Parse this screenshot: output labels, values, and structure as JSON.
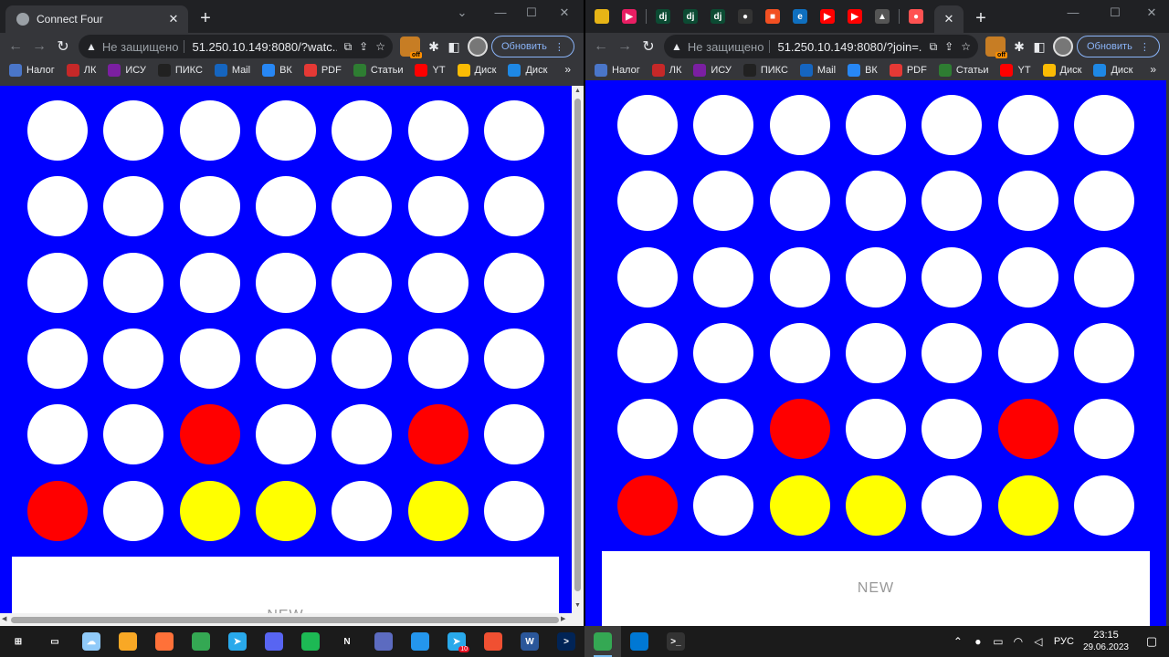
{
  "left_window": {
    "tab_title": "Connect Four",
    "address": {
      "not_secure": "Не защищено",
      "url": "51.250.10.149:8080/?watc..."
    },
    "update_label": "Обновить",
    "new_label": "NEW",
    "board": [
      [
        "empty",
        "empty",
        "empty",
        "empty",
        "empty",
        "empty",
        "empty"
      ],
      [
        "empty",
        "empty",
        "empty",
        "empty",
        "empty",
        "empty",
        "empty"
      ],
      [
        "empty",
        "empty",
        "empty",
        "empty",
        "empty",
        "empty",
        "empty"
      ],
      [
        "empty",
        "empty",
        "empty",
        "empty",
        "empty",
        "empty",
        "empty"
      ],
      [
        "empty",
        "empty",
        "red",
        "empty",
        "empty",
        "red",
        "empty"
      ],
      [
        "red",
        "empty",
        "yellow",
        "yellow",
        "empty",
        "yellow",
        "empty"
      ]
    ]
  },
  "right_window": {
    "address": {
      "not_secure": "Не защищено",
      "url": "51.250.10.149:8080/?join=..."
    },
    "update_label": "Обновить",
    "new_label": "NEW",
    "pinned_tabs": [
      {
        "icon": "pinwheel-icon",
        "label": "",
        "color": "#e7b416"
      },
      {
        "icon": "play-icon",
        "label": "▶",
        "color": "#e91e63"
      },
      {
        "icon": "django-icon",
        "label": "dj",
        "color": "#0c4b33"
      },
      {
        "icon": "django-icon",
        "label": "dj",
        "color": "#0c4b33"
      },
      {
        "icon": "django-icon",
        "label": "dj",
        "color": "#0c4b33"
      },
      {
        "icon": "github-icon",
        "label": "●",
        "color": "#333333"
      },
      {
        "icon": "microsoft-icon",
        "label": "■",
        "color": "#f25022"
      },
      {
        "icon": "edge-icon",
        "label": "e",
        "color": "#0f6fbf"
      },
      {
        "icon": "youtube-icon",
        "label": "▶",
        "color": "#ff0000"
      },
      {
        "icon": "youtube-icon",
        "label": "▶",
        "color": "#ff0000"
      },
      {
        "icon": "tent-icon",
        "label": "▲",
        "color": "#555555"
      },
      {
        "icon": "record-icon",
        "label": "●",
        "color": "#ff5252"
      }
    ],
    "board": [
      [
        "empty",
        "empty",
        "empty",
        "empty",
        "empty",
        "empty",
        "empty"
      ],
      [
        "empty",
        "empty",
        "empty",
        "empty",
        "empty",
        "empty",
        "empty"
      ],
      [
        "empty",
        "empty",
        "empty",
        "empty",
        "empty",
        "empty",
        "empty"
      ],
      [
        "empty",
        "empty",
        "empty",
        "empty",
        "empty",
        "empty",
        "empty"
      ],
      [
        "empty",
        "empty",
        "red",
        "empty",
        "empty",
        "red",
        "empty"
      ],
      [
        "red",
        "empty",
        "yellow",
        "yellow",
        "empty",
        "yellow",
        "empty"
      ]
    ]
  },
  "bookmarks": [
    {
      "label": "Налог",
      "icon": "tax-icon",
      "color": "#4a76c9"
    },
    {
      "label": "ЛК",
      "icon": "lk-icon",
      "color": "#c62828"
    },
    {
      "label": "ИСУ",
      "icon": "isu-icon",
      "color": "#7b1fa2"
    },
    {
      "label": "ПИКС",
      "icon": "piks-icon",
      "color": "#212121"
    },
    {
      "label": "Mail",
      "icon": "mail-icon",
      "color": "#1565c0"
    },
    {
      "label": "ВК",
      "icon": "vk-icon",
      "color": "#2787f5"
    },
    {
      "label": "PDF",
      "icon": "pdf-icon",
      "color": "#e53935"
    },
    {
      "label": "Статьи",
      "icon": "articles-icon",
      "color": "#2e7d32"
    },
    {
      "label": "YT",
      "icon": "youtube-icon",
      "color": "#ff0000"
    },
    {
      "label": "Диск",
      "icon": "drive-icon",
      "color": "#fbbc04"
    },
    {
      "label": "Диск",
      "icon": "drive-icon",
      "color": "#1e88e5"
    }
  ],
  "colors": {
    "board": "#0000ff",
    "red": "#ff0000",
    "yellow": "#ffff00",
    "empty": "#ffffff"
  },
  "taskbar": {
    "apps": [
      {
        "name": "start-button",
        "icon": "windows-icon",
        "color": "#ffffff",
        "label": "⊞"
      },
      {
        "name": "task-view-button",
        "icon": "task-view-icon",
        "color": "#ffffff",
        "label": "▭"
      },
      {
        "name": "weather-widget",
        "icon": "weather-icon",
        "color": "#90caf9",
        "label": "☁"
      },
      {
        "name": "explorer-button",
        "icon": "folder-icon",
        "color": "#f9a825",
        "label": ""
      },
      {
        "name": "firefox-button",
        "icon": "firefox-icon",
        "color": "#ff7139",
        "label": ""
      },
      {
        "name": "chrome-button",
        "icon": "chrome-icon",
        "color": "#34a853",
        "label": ""
      },
      {
        "name": "telegram-button",
        "icon": "telegram-icon",
        "color": "#29a9eb",
        "label": "➤"
      },
      {
        "name": "discord-button",
        "icon": "discord-icon",
        "color": "#5865f2",
        "label": ""
      },
      {
        "name": "spotify-button",
        "icon": "spotify-icon",
        "color": "#1db954",
        "label": ""
      },
      {
        "name": "notion-button",
        "icon": "notion-icon",
        "color": "#ffffff",
        "label": "N"
      },
      {
        "name": "calculator-button",
        "icon": "calculator-icon",
        "color": "#5c6bc0",
        "label": ""
      },
      {
        "name": "docker-button",
        "icon": "docker-icon",
        "color": "#2496ed",
        "label": ""
      },
      {
        "name": "telegram-2-button",
        "icon": "telegram-icon",
        "color": "#29a9eb",
        "label": "➤",
        "badge": "10"
      },
      {
        "name": "git-button",
        "icon": "git-icon",
        "color": "#f05032",
        "label": ""
      },
      {
        "name": "word-button",
        "icon": "word-icon",
        "color": "#2b579a",
        "label": "W"
      },
      {
        "name": "powershell-button",
        "icon": "powershell-icon",
        "color": "#012456",
        "label": ">"
      },
      {
        "name": "chrome-2-button",
        "icon": "chrome-icon",
        "color": "#34a853",
        "label": "",
        "active": true
      },
      {
        "name": "vscode-button",
        "icon": "vscode-icon",
        "color": "#0078d4",
        "label": ""
      },
      {
        "name": "terminal-button",
        "icon": "terminal-icon",
        "color": "#333333",
        "label": ">_"
      }
    ],
    "language": "РУС",
    "time": "23:15",
    "date": "29.06.2023"
  }
}
